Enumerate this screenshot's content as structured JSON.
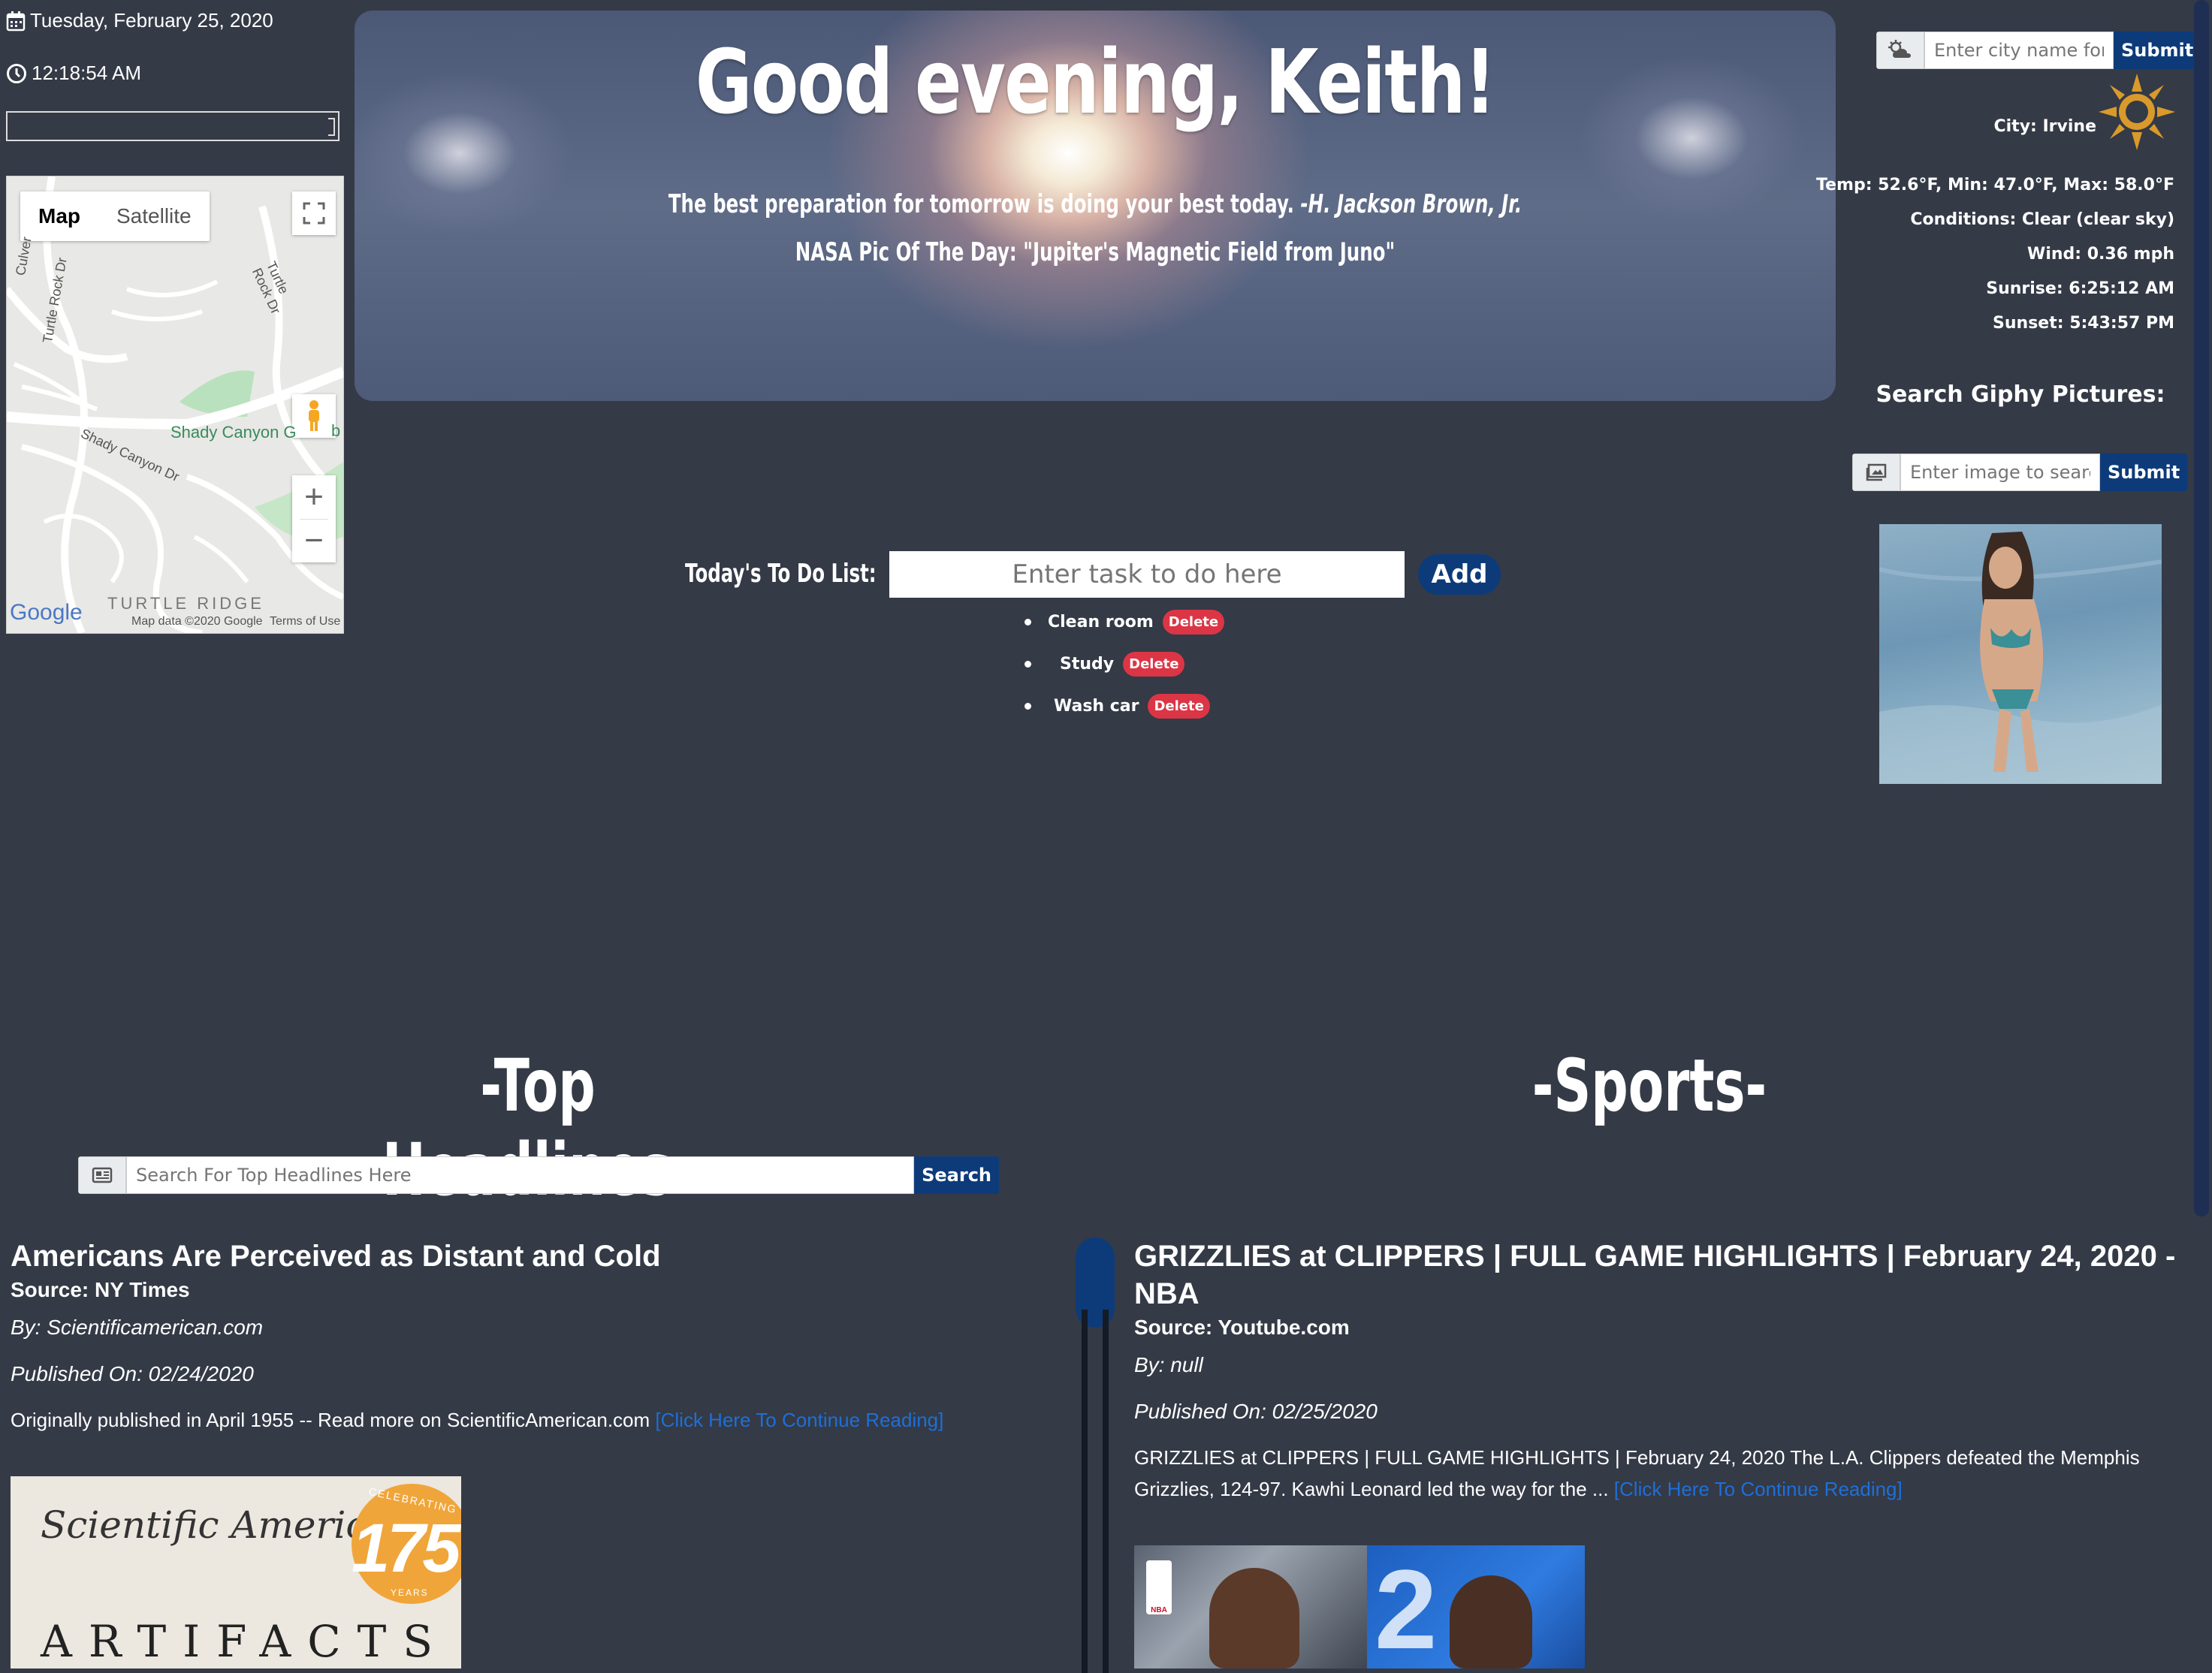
{
  "left": {
    "date": "Tuesday, February 25, 2020",
    "time": "12:18:54 AM",
    "map": {
      "tab_map": "Map",
      "tab_satellite": "Satellite",
      "label_shady": "Shady Canyon G",
      "label_b": "b",
      "label_turtle_rock_dr": "Turtle Rock Dr",
      "label_turtle_rock_dr2": "Turtle Rock Dr",
      "label_shady_canyon_dr": "Shady Canyon Dr",
      "label_culver": "Culver",
      "label_turtle_ridge": "TURTLE RIDGE",
      "label_google": "Google",
      "label_mapdata": "Map data ©2020 Google",
      "label_terms": "Terms of Use",
      "zoom_in": "+",
      "zoom_out": "−"
    }
  },
  "hero": {
    "greeting": "Good evening, Keith!",
    "quote": "The best preparation for tomorrow is doing your best today.",
    "quote_author": "-H. Jackson Brown, Jr.",
    "nasa": "NASA Pic Of The Day: \"Jupiter's Magnetic Field from Juno\""
  },
  "weather": {
    "placeholder": "Enter city name for weather",
    "submit": "Submit",
    "city": "City: Irvine",
    "temp": "Temp: 52.6°F, Min: 47.0°F, Max: 58.0°F",
    "conditions": "Conditions: Clear (clear sky)",
    "wind": "Wind: 0.36 mph",
    "sunrise": "Sunrise: 6:25:12 AM",
    "sunset": "Sunset: 5:43:57 PM",
    "icon": "sun-icon",
    "sun_color": "#d99a2b"
  },
  "giphy": {
    "title": "Search Giphy Pictures:",
    "placeholder": "Enter image to search",
    "submit": "Submit"
  },
  "todo": {
    "label": "Today's To Do List:",
    "placeholder": "Enter task to do here",
    "add": "Add",
    "delete_label": "Delete",
    "items": [
      "Clean room",
      "Study",
      "Wash car"
    ]
  },
  "headlines": {
    "title": "-Top Headlines-",
    "search_placeholder": "Search For Top Headlines Here",
    "search_button": "Search",
    "article": {
      "title": "Americans Are Perceived as Distant and Cold",
      "source": "Source: NY Times",
      "by": "By: Scientificamerican.com",
      "published": "Published On: 02/24/2020",
      "body": "Originally published in April 1955 -- Read more on ScientificAmerican.com",
      "link": "[Click Here To Continue Reading]",
      "img_brand": "Scientific American.",
      "img_number": "175",
      "img_celebrating": "CELEBRATING",
      "img_years": "YEARS",
      "img_artifacts": "ARTIFACTS"
    }
  },
  "sports": {
    "title": "-Sports-",
    "article": {
      "title": "GRIZZLIES at CLIPPERS | FULL GAME HIGHLIGHTS | February 24, 2020 - NBA",
      "source": "Source: Youtube.com",
      "by": "By: null",
      "published": "Published On: 02/25/2020",
      "body": "GRIZZLIES at CLIPPERS | FULL GAME HIGHLIGHTS | February 24, 2020 The L.A. Clippers defeated the Memphis Grizzlies, 124-97. Kawhi Leonard led the way for the ...",
      "link": "[Click Here To Continue Reading]",
      "img_badge": "NBA"
    }
  },
  "colors": {
    "background": "#343a46",
    "accent": "#0d3b7a",
    "delete": "#dc3545",
    "link": "#1e6fd9"
  }
}
